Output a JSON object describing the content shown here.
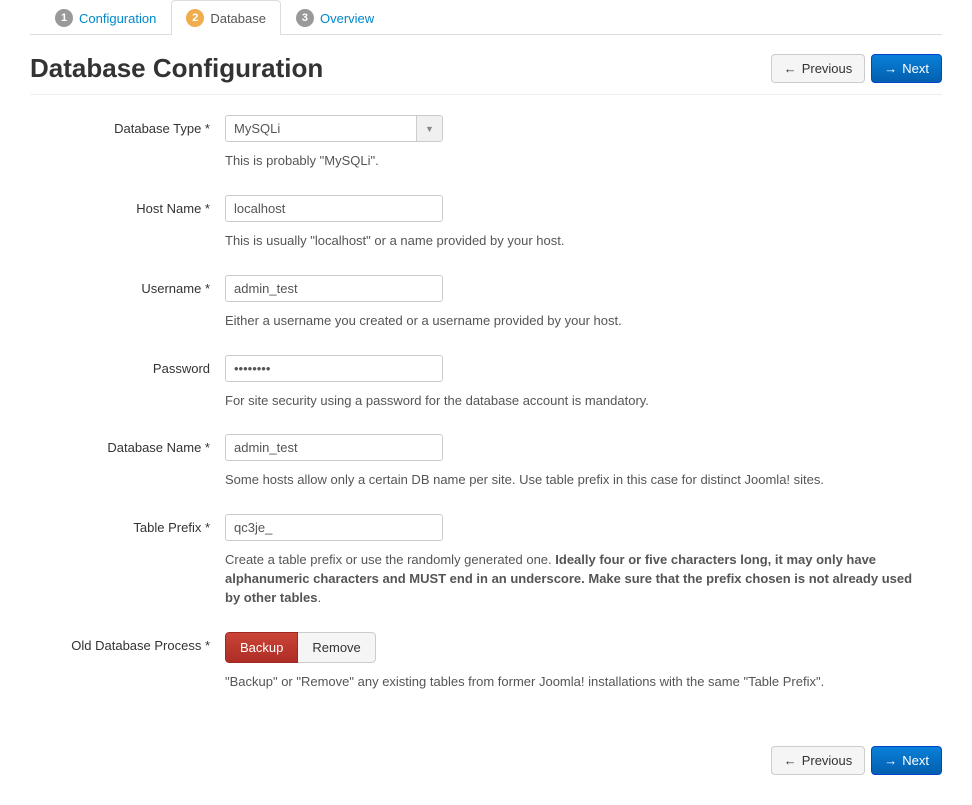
{
  "tabs": [
    {
      "num": "1",
      "label": "Configuration"
    },
    {
      "num": "2",
      "label": "Database"
    },
    {
      "num": "3",
      "label": "Overview"
    }
  ],
  "heading": "Database Configuration",
  "buttons": {
    "previous": "Previous",
    "next": "Next"
  },
  "fields": {
    "db_type": {
      "label": "Database Type *",
      "value": "MySQLi",
      "help": "This is probably \"MySQLi\"."
    },
    "host": {
      "label": "Host Name *",
      "value": "localhost",
      "help": "This is usually \"localhost\" or a name provided by your host."
    },
    "username": {
      "label": "Username *",
      "value": "admin_test",
      "help": "Either a username you created or a username provided by your host."
    },
    "password": {
      "label": "Password",
      "value": "••••••••",
      "help": "For site security using a password for the database account is mandatory."
    },
    "db_name": {
      "label": "Database Name *",
      "value": "admin_test",
      "help": "Some hosts allow only a certain DB name per site. Use table prefix in this case for distinct Joomla! sites."
    },
    "prefix": {
      "label": "Table Prefix *",
      "value": "qc3je_",
      "help_pre": "Create a table prefix or use the randomly generated one. ",
      "help_bold": "Ideally four or five characters long, it may only have alphanumeric characters and MUST end in an underscore. Make sure that the prefix chosen is not already used by other tables",
      "help_post": "."
    },
    "old_db": {
      "label": "Old Database Process *",
      "backup": "Backup",
      "remove": "Remove",
      "help": "\"Backup\" or \"Remove\" any existing tables from former Joomla! installations with the same \"Table Prefix\"."
    }
  }
}
